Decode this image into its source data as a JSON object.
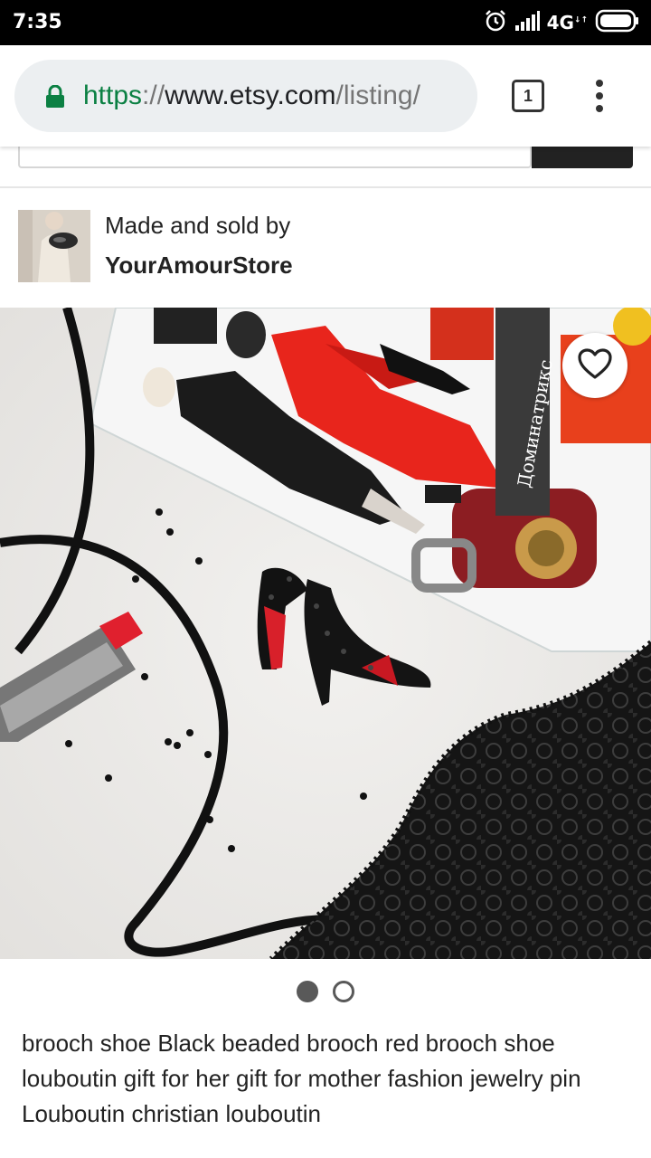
{
  "status_bar": {
    "time": "7:35",
    "network": "4G",
    "network_sub": "↓↑",
    "icons": [
      "alarm-icon",
      "signal-icon",
      "battery-icon"
    ]
  },
  "browser": {
    "url_scheme": "https",
    "url_separator": "://",
    "url_host": "www.etsy.com",
    "url_path": "/listing/",
    "tab_count": "1",
    "secure_color": "#0b8043"
  },
  "seller": {
    "label": "Made and sold by",
    "name": "YourAmourStore"
  },
  "listing": {
    "title": "brooch shoe Black beaded brooch red brooch shoe louboutin gift for her gift for mother fashion jewelry pin Louboutin christian louboutin",
    "image_count": 2,
    "current_image": 1
  },
  "colors": {
    "accent": "#222222",
    "lipstick_red": "#e0202e",
    "dress_red": "#e8251c"
  }
}
